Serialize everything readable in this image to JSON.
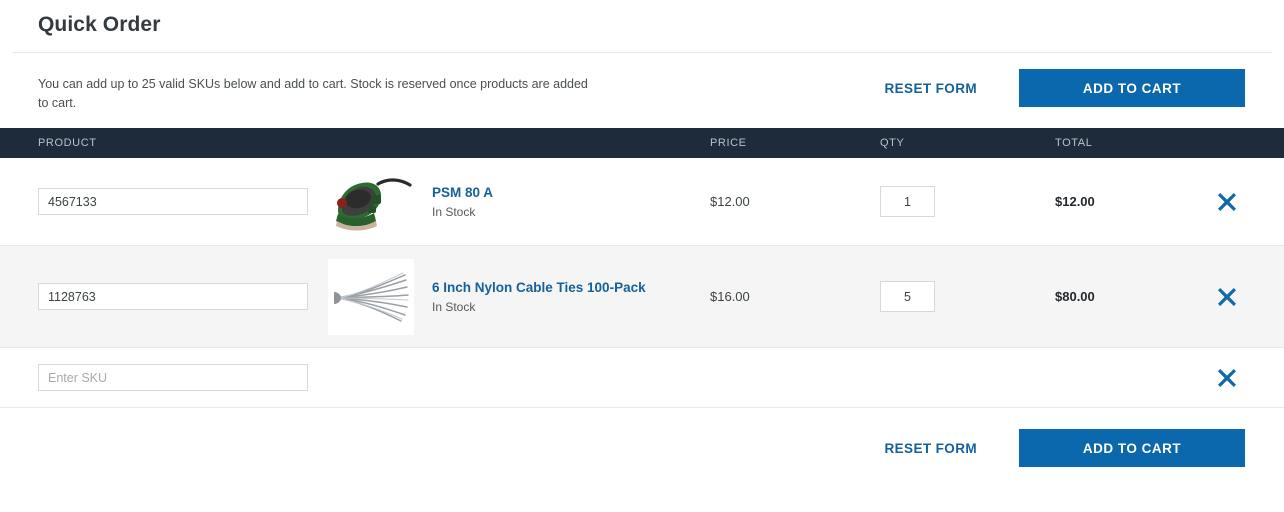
{
  "header": {
    "title": "Quick Order"
  },
  "intro": {
    "description": "You can add up to 25 valid SKUs below and add to cart. Stock is reserved once products are added to cart."
  },
  "toolbar_top": {
    "reset_label": "RESET FORM",
    "add_to_cart_label": "ADD TO CART"
  },
  "toolbar_bottom": {
    "reset_label": "RESET FORM",
    "add_to_cart_label": "ADD TO CART"
  },
  "table": {
    "columns": {
      "product": "PRODUCT",
      "price": "PRICE",
      "qty": "QTY",
      "total": "TOTAL"
    },
    "rows": [
      {
        "sku": "4567133",
        "sku_placeholder": "Enter SKU",
        "name": "PSM 80 A",
        "stock": "In Stock",
        "price": "$12.00",
        "qty": "1",
        "total": "$12.00",
        "remove_icon": "close-x-icon",
        "image": "palm-sander-green"
      },
      {
        "sku": "1128763",
        "sku_placeholder": "Enter SKU",
        "name": "6 Inch Nylon Cable Ties 100-Pack",
        "stock": "In Stock",
        "price": "$16.00",
        "qty": "5",
        "total": "$80.00",
        "remove_icon": "close-x-icon",
        "image": "cable-ties-bundle"
      },
      {
        "sku": "",
        "sku_placeholder": "Enter SKU",
        "name": "",
        "stock": "",
        "price": "",
        "qty": "",
        "total": "",
        "remove_icon": "close-x-icon",
        "image": ""
      }
    ]
  },
  "colors": {
    "accent_blue": "#0b68ac",
    "link_blue": "#15619b",
    "header_bar": "#1d2b3a",
    "alt_row": "#f5f5f5",
    "border": "#e7e8ea"
  }
}
